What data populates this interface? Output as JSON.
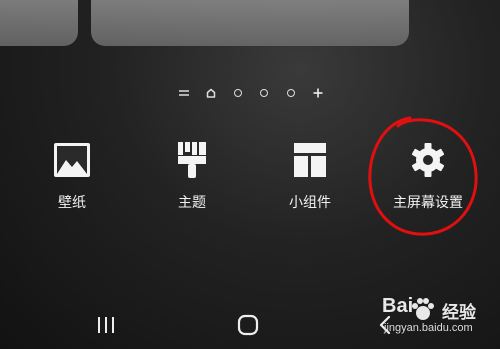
{
  "page_indicator": {
    "items": [
      {
        "type": "menu",
        "icon": "hamburger-icon"
      },
      {
        "type": "home",
        "icon": "home-icon"
      },
      {
        "type": "dot"
      },
      {
        "type": "dot"
      },
      {
        "type": "dot"
      },
      {
        "type": "add",
        "icon": "plus-icon"
      }
    ]
  },
  "actions": {
    "wallpaper": {
      "label": "壁纸",
      "icon": "image-icon"
    },
    "themes": {
      "label": "主题",
      "icon": "paintbrush-icon"
    },
    "widgets": {
      "label": "小组件",
      "icon": "widgets-icon"
    },
    "settings": {
      "label": "主屏幕设置",
      "icon": "gear-icon"
    }
  },
  "navbar": {
    "recents_icon": "recents-icon",
    "home_icon": "home-button-icon",
    "back_icon": "back-icon"
  },
  "annotation": {
    "color": "#e01010"
  },
  "watermark": {
    "brand": "Bai",
    "site": "经验",
    "url": "jingyan.baidu.com"
  }
}
